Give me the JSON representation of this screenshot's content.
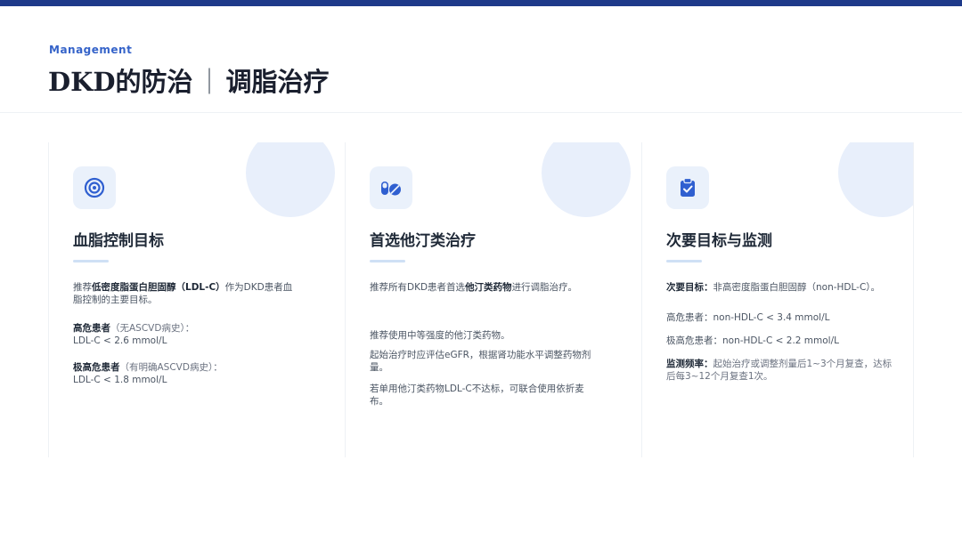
{
  "header": {
    "eyebrow": "Management",
    "title_main": "DKD的防治",
    "title_sep": "｜",
    "title_sub": "调脂治疗"
  },
  "colors": {
    "accent": "#1e3a8a",
    "eyebrow": "#3563c9",
    "icon": "#2f5fd0",
    "circle": "#e8effb"
  },
  "cards": [
    {
      "icon": "target-icon",
      "title": "血脂控制目标",
      "p1_pre": "推荐",
      "p1_bold": "低密度脂蛋白胆固醇（LDL-C）",
      "p1_post": "作为DKD患者血脂控制的主要目标。",
      "p2_bold": "高危患者",
      "p2_note": "（无ASCVD病史）：",
      "p2_value": "LDL-C < 2.6 mmol/L",
      "p3_bold": "极高危患者",
      "p3_note": "（有明确ASCVD病史）：",
      "p3_value": "LDL-C < 1.8 mmol/L"
    },
    {
      "icon": "pills-icon",
      "title": "首选他汀类治疗",
      "p1_pre": "推荐所有DKD患者首选",
      "p1_bold": "他汀类药物",
      "p1_post": "进行调脂治疗。",
      "p2": "推荐使用中等强度的他汀类药物。",
      "p3": "起始治疗时应评估eGFR，根据肾功能水平调整药物剂量。",
      "p4": "若单用他汀类药物LDL-C不达标，可联合使用依折麦布。"
    },
    {
      "icon": "clipboard-check-icon",
      "title": "次要目标与监测",
      "p1_bold": "次要目标：",
      "p1_post": "非高密度脂蛋白胆固醇（non-HDL-C）。",
      "p2": "高危患者：non-HDL-C < 3.4 mmol/L",
      "p3": "极高危患者：non-HDL-C < 2.2 mmol/L",
      "p4_bold": "监测频率：",
      "p4_post": "起始治疗或调整剂量后1~3个月复查，达标后每3~12个月复查1次。"
    }
  ]
}
